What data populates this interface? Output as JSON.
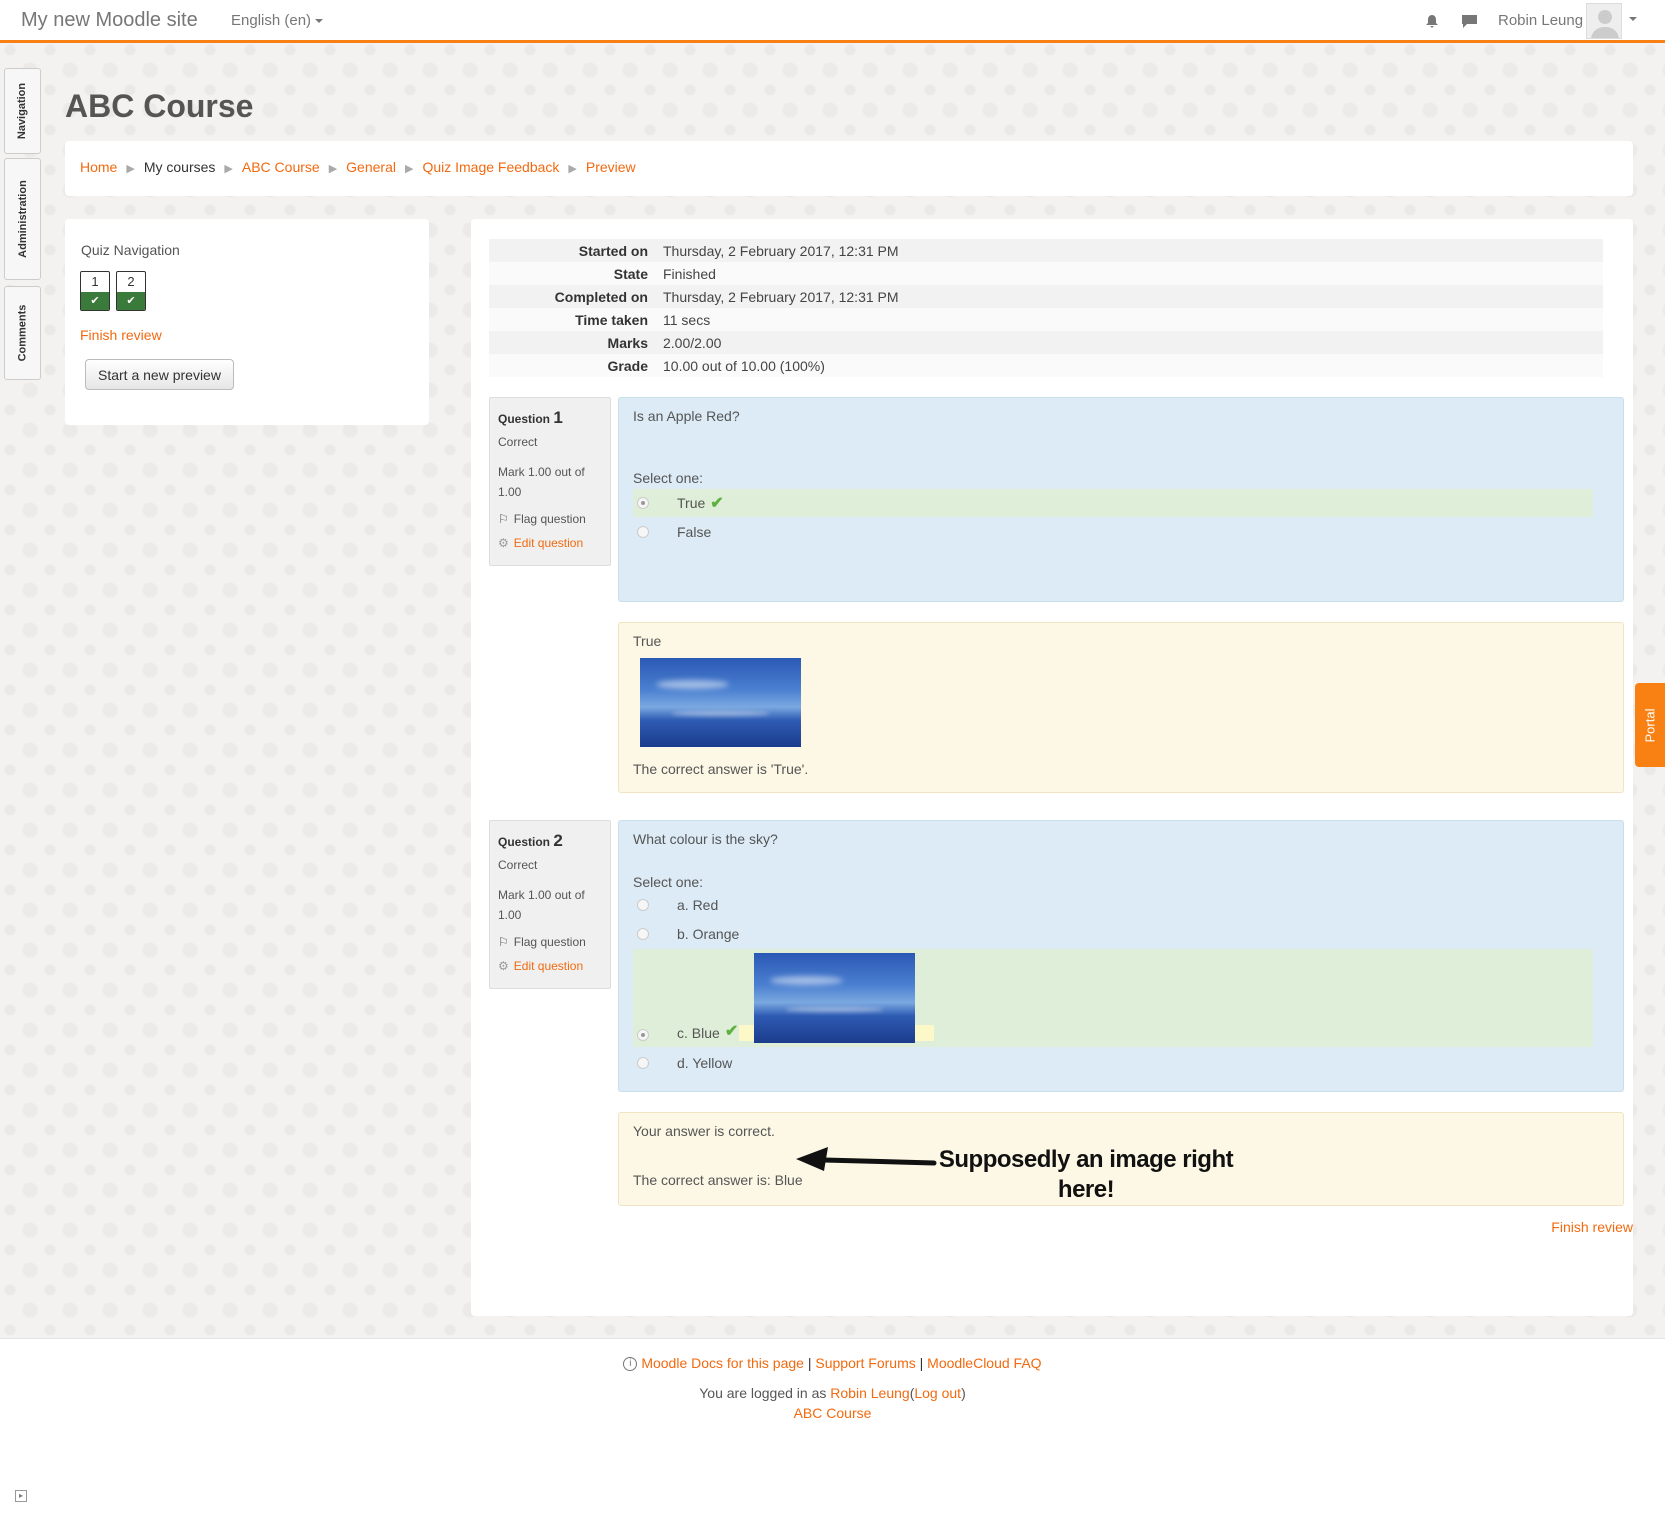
{
  "navbar": {
    "site_name": "My new Moodle site",
    "language": "English (en)",
    "user_name": "Robin Leung"
  },
  "dock": {
    "tabs": [
      "Navigation",
      "Administration",
      "Comments"
    ]
  },
  "portal_label": "Portal",
  "course_title": "ABC Course",
  "breadcrumb": [
    "Home",
    "My courses",
    "ABC Course",
    "General",
    "Quiz Image Feedback",
    "Preview"
  ],
  "quiz_nav": {
    "title": "Quiz Navigation",
    "buttons": [
      "1",
      "2"
    ],
    "finish_review": "Finish review",
    "start_new_preview": "Start a new preview"
  },
  "summary": [
    {
      "label": "Started on",
      "value": "Thursday, 2 February 2017, 12:31 PM"
    },
    {
      "label": "State",
      "value": "Finished"
    },
    {
      "label": "Completed on",
      "value": "Thursday, 2 February 2017, 12:31 PM"
    },
    {
      "label": "Time taken",
      "value": "11 secs"
    },
    {
      "label": "Marks",
      "value": "2.00/2.00"
    },
    {
      "label": "Grade",
      "value": "10.00 out of 10.00 (100%)"
    }
  ],
  "questions": [
    {
      "label": "Question",
      "number": "1",
      "status": "Correct",
      "mark": "Mark 1.00 out of 1.00",
      "flag": "Flag question",
      "edit": "Edit question",
      "text": "Is an Apple Red?",
      "prompt": "Select one:",
      "answers": [
        "True",
        "False"
      ],
      "feedback_answer": "True",
      "feedback_right": "The correct answer is 'True'."
    },
    {
      "label": "Question",
      "number": "2",
      "status": "Correct",
      "mark": "Mark 1.00 out of 1.00",
      "flag": "Flag question",
      "edit": "Edit question",
      "text": "What colour is the sky?",
      "prompt": "Select one:",
      "answers": [
        "a. Red",
        "b. Orange",
        "c. Blue",
        "d. Yellow"
      ],
      "feedback_general": "Your answer is correct.",
      "feedback_right": "The correct answer is: Blue"
    }
  ],
  "annotation": {
    "line1": "Supposedly an image right",
    "line2": "here!"
  },
  "finish_review_bottom": "Finish review",
  "footer": {
    "docs": "Moodle Docs for this page",
    "sep": "|",
    "forums": "Support Forums",
    "faq": "MoodleCloud FAQ",
    "logged_prefix": "You are logged in as",
    "user": "Robin Leung",
    "logout": "Log out",
    "course": "ABC Course"
  }
}
